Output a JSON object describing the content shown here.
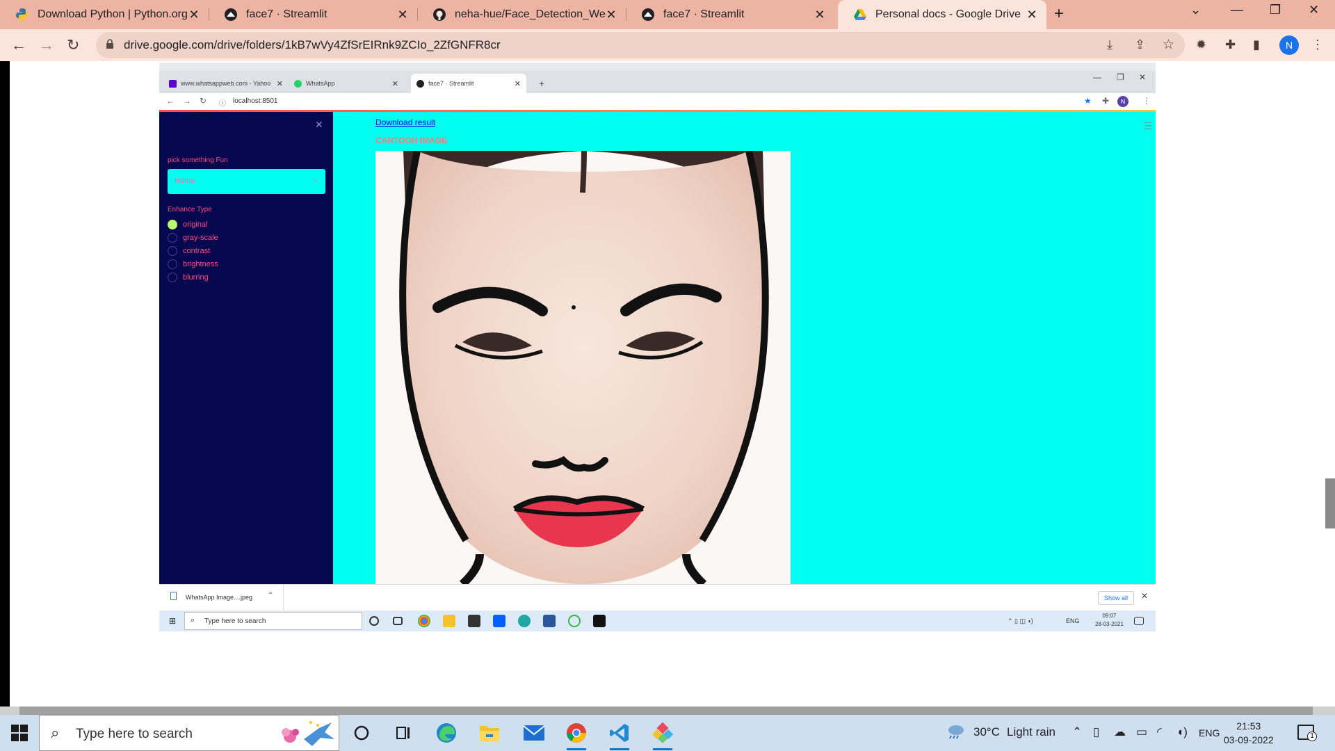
{
  "browser": {
    "tabs": [
      {
        "title": "Download Python | Python.org",
        "icon": "python-icon"
      },
      {
        "title": "face7 · Streamlit",
        "icon": "streamlit-icon"
      },
      {
        "title": "neha-hue/Face_Detection_WebA",
        "icon": "github-icon"
      },
      {
        "title": "face7 · Streamlit",
        "icon": "streamlit-icon"
      },
      {
        "title": "Personal docs - Google Drive",
        "icon": "google-drive-icon"
      }
    ],
    "active_tab": 4,
    "url": "drive.google.com/drive/folders/1kB7wVy4ZfSrEIRnk9ZCIo_2ZfGNFR8cr",
    "profile_initial": "N",
    "accent": "#edb4a3"
  },
  "screenshot": {
    "tabs": [
      {
        "title": "www.whatsappweb.com - Yahoo"
      },
      {
        "title": "WhatsApp"
      },
      {
        "title": "face7 · Streamlit"
      }
    ],
    "url": "localhost:8501",
    "profile_initial": "N",
    "sidebar": {
      "pick_label": "pick something Fun",
      "select_value": "Home",
      "enhance_label": "Enhance Type",
      "options": [
        "original",
        "gray-scale",
        "contrast",
        "brightness",
        "blurring"
      ],
      "selected": 0
    },
    "main": {
      "download_link": "Download result",
      "caption": "CARTOON IMAGE",
      "background": "#00fff0"
    },
    "download": {
      "file": "WhatsApp Image....jpeg",
      "show_all": "Show all"
    },
    "taskbar": {
      "search": "Type here to search",
      "lang": "ENG",
      "time": "09:07",
      "date": "28-03-2021"
    }
  },
  "taskbar": {
    "search_placeholder": "Type here to search",
    "weather_temp": "30°C",
    "weather_text": "Light rain",
    "lang": "ENG",
    "time": "21:53",
    "date": "03-09-2022",
    "notification_count": "1"
  }
}
